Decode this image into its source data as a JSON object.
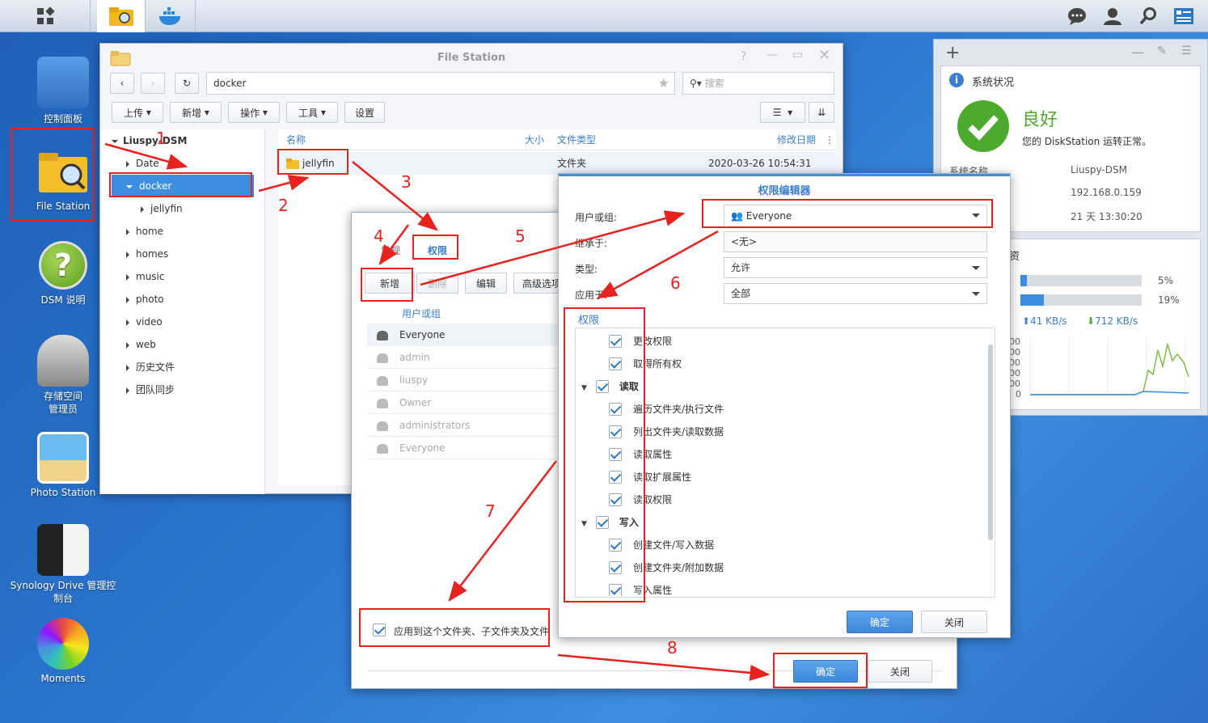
{
  "desktop": {
    "icons": [
      {
        "label": "控制面板"
      },
      {
        "label": "File Station"
      },
      {
        "label": "DSM 说明"
      },
      {
        "label": "存储空间\n管理员"
      },
      {
        "label": "Photo Station"
      },
      {
        "label": "Synology Drive 管理控\n制台"
      },
      {
        "label": "Moments"
      }
    ]
  },
  "file_station": {
    "title": "File Station",
    "path": "docker",
    "search_placeholder": "搜索",
    "toolbar": {
      "upload": "上传",
      "create": "新增",
      "action": "操作",
      "tools": "工具",
      "settings": "设置"
    },
    "tree": {
      "root": "Liuspy-DSM",
      "items": [
        "Date",
        "docker",
        "jellyfin",
        "home",
        "homes",
        "music",
        "photo",
        "video",
        "web",
        "历史文件",
        "团队同步"
      ]
    },
    "columns": {
      "name": "名称",
      "size": "大小",
      "type": "文件类型",
      "modified": "修改日期"
    },
    "rows": [
      {
        "name": "jellyfin",
        "size": "",
        "type": "文件夹",
        "modified": "2020-03-26 10:54:31"
      }
    ]
  },
  "properties": {
    "tabs": {
      "general": "常规",
      "permission": "权限"
    },
    "buttons": {
      "add": "新增",
      "delete": "删除",
      "edit": "编辑",
      "advanced": "高级选项"
    },
    "user_header": "用户或组",
    "users": [
      "Everyone",
      "admin",
      "liuspy",
      "Owner",
      "administrators",
      "Everyone"
    ],
    "apply_label": "应用到这个文件夹、子文件夹及文件",
    "ok": "确定",
    "close": "关闭"
  },
  "perm_editor": {
    "title": "权限编辑器",
    "labels": {
      "user": "用户或组:",
      "inherit": "继承于:",
      "type": "类型:",
      "apply": "应用于:"
    },
    "values": {
      "user": "Everyone",
      "inherit": "<无>",
      "type": "允许",
      "apply": "全部"
    },
    "perm_title": "权限",
    "perms": [
      {
        "label": "更改权限",
        "group": false
      },
      {
        "label": "取得所有权",
        "group": false
      },
      {
        "label": "读取",
        "group": true
      },
      {
        "label": "遍历文件夹/执行文件",
        "group": false
      },
      {
        "label": "列出文件夹/读取数据",
        "group": false
      },
      {
        "label": "读取属性",
        "group": false
      },
      {
        "label": "读取扩展属性",
        "group": false
      },
      {
        "label": "读取权限",
        "group": false
      },
      {
        "label": "写入",
        "group": true
      },
      {
        "label": "创建文件/写入数据",
        "group": false
      },
      {
        "label": "创建文件夹/附加数据",
        "group": false
      },
      {
        "label": "写入属性",
        "group": false
      }
    ],
    "ok": "确定",
    "close": "关闭"
  },
  "widget": {
    "status_title": "系统状况",
    "status": "良好",
    "status_desc": "您的 DiskStation 运转正常。",
    "info_labels": [
      "系统名称"
    ],
    "info_values": [
      "Liuspy-DSM",
      "192.168.0.159",
      "21 天 13:30:20"
    ],
    "cpu_pct": "5%",
    "ram_pct": "19%",
    "cpu_level": 5,
    "ram_level": 19,
    "upload": "41 KB/s",
    "download": "712 KB/s",
    "axis": [
      "00",
      "00",
      "00",
      "00",
      "00",
      "0"
    ],
    "section_frag": "资"
  },
  "annotations": [
    "1",
    "2",
    "3",
    "4",
    "5",
    "6",
    "7",
    "8"
  ],
  "colors": {
    "red": "#e8231f",
    "blue": "#2f78c8",
    "green": "#4caa2f"
  }
}
